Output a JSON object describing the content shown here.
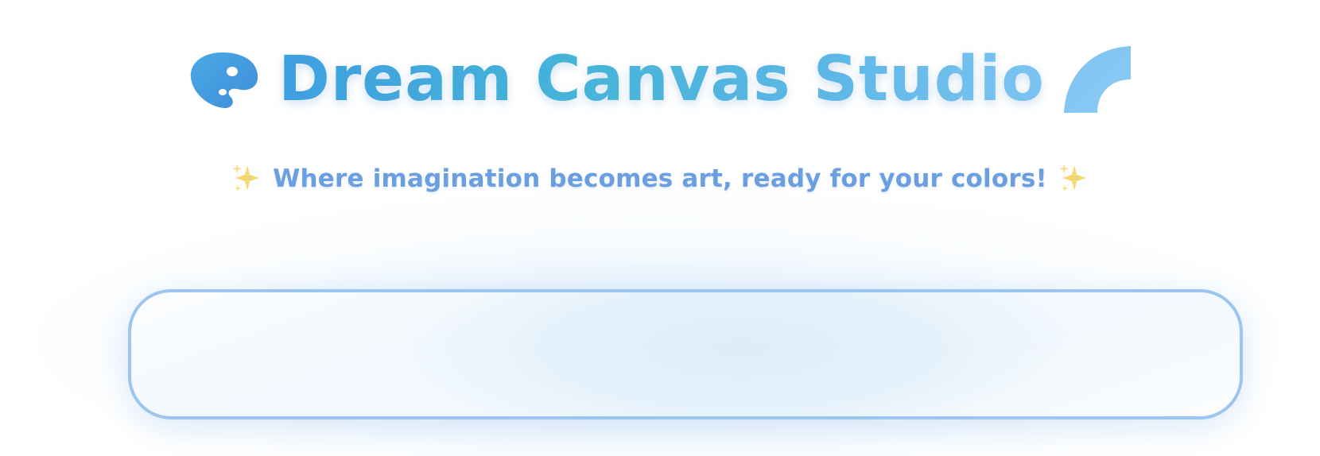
{
  "header": {
    "title": "Dream Canvas Studio",
    "left_icon": "artist-palette-icon",
    "right_icon": "rainbow-arc-icon"
  },
  "subtitle": {
    "text": "Where imagination becomes art, ready for your colors!",
    "icon": "sparkles-icon"
  },
  "canvas": {
    "label": ""
  },
  "colors": {
    "title_start": "#3f9fdf",
    "title_end": "#7cc4f2",
    "subtitle": "#6b9fe0",
    "canvas_border": "#9cc6f0",
    "sparkle": "#f7d774"
  }
}
